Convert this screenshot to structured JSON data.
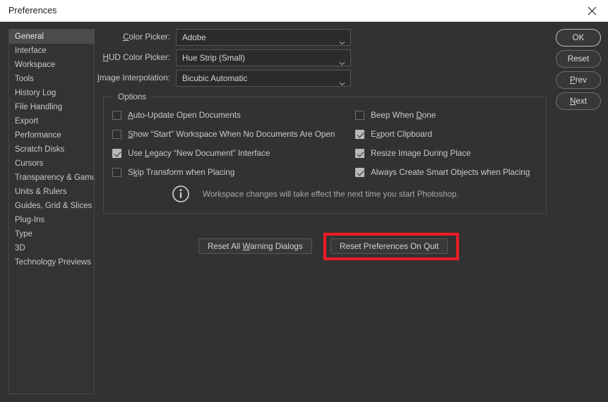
{
  "window": {
    "title": "Preferences",
    "close_icon": "close-icon"
  },
  "sidebar": {
    "items": [
      {
        "label": "General",
        "selected": true
      },
      {
        "label": "Interface",
        "selected": false
      },
      {
        "label": "Workspace",
        "selected": false
      },
      {
        "label": "Tools",
        "selected": false
      },
      {
        "label": "History Log",
        "selected": false
      },
      {
        "label": "File Handling",
        "selected": false
      },
      {
        "label": "Export",
        "selected": false
      },
      {
        "label": "Performance",
        "selected": false
      },
      {
        "label": "Scratch Disks",
        "selected": false
      },
      {
        "label": "Cursors",
        "selected": false
      },
      {
        "label": "Transparency & Gamut",
        "selected": false
      },
      {
        "label": "Units & Rulers",
        "selected": false
      },
      {
        "label": "Guides, Grid & Slices",
        "selected": false
      },
      {
        "label": "Plug-Ins",
        "selected": false
      },
      {
        "label": "Type",
        "selected": false
      },
      {
        "label": "3D",
        "selected": false
      },
      {
        "label": "Technology Previews",
        "selected": false
      }
    ]
  },
  "fields": [
    {
      "label_pre": "",
      "label_accel": "C",
      "label_post": "olor Picker:",
      "value": "Adobe"
    },
    {
      "label_pre": "",
      "label_accel": "H",
      "label_post": "UD Color Picker:",
      "value": "Hue Strip (Small)"
    },
    {
      "label_pre": "",
      "label_accel": "I",
      "label_post": "mage Interpolation:",
      "value": "Bicubic Automatic"
    }
  ],
  "options": {
    "legend": "Options",
    "left_column": [
      {
        "pre": "",
        "accel": "A",
        "post": "uto-Update Open Documents",
        "checked": false
      },
      {
        "pre": "",
        "accel": "S",
        "post": "how “Start” Workspace When No Documents Are Open",
        "checked": false
      },
      {
        "pre": "Use ",
        "accel": "L",
        "post": "egacy “New Document” Interface",
        "checked": true
      },
      {
        "pre": "S",
        "accel": "k",
        "post": "ip Transform when Placing",
        "checked": false
      }
    ],
    "right_column": [
      {
        "pre": "Beep When ",
        "accel": "D",
        "post": "one",
        "checked": false
      },
      {
        "pre": "E",
        "accel": "x",
        "post": "port Clipboard",
        "checked": true
      },
      {
        "pre": "Resize Ima",
        "accel": "g",
        "post": "e During Place",
        "checked": true
      },
      {
        "pre": "Always Create Smart Ob",
        "accel": "j",
        "post": "ects when Placing",
        "checked": true
      }
    ],
    "note": {
      "icon": "info-icon",
      "text": "Workspace changes will take effect the next time you start Photoshop."
    }
  },
  "bottom_buttons": [
    {
      "pre": "Reset All ",
      "accel": "W",
      "post": "arning Dialogs",
      "highlighted": false
    },
    {
      "pre": "Reset Preferences On Quit",
      "accel": "",
      "post": "",
      "highlighted": true
    }
  ],
  "right_buttons": [
    {
      "pre": "OK",
      "accel": "",
      "post": "",
      "primary": true
    },
    {
      "pre": "Reset",
      "accel": "",
      "post": "",
      "primary": false
    },
    {
      "pre": "",
      "accel": "P",
      "post": "rev",
      "primary": false
    },
    {
      "pre": "",
      "accel": "N",
      "post": "ext",
      "primary": false
    }
  ],
  "colors": {
    "annotation": "#ED1C24",
    "dialog_bg": "#323232",
    "titlebar_bg": "#FFFFFF",
    "selection_bg": "#4C4C4C"
  }
}
